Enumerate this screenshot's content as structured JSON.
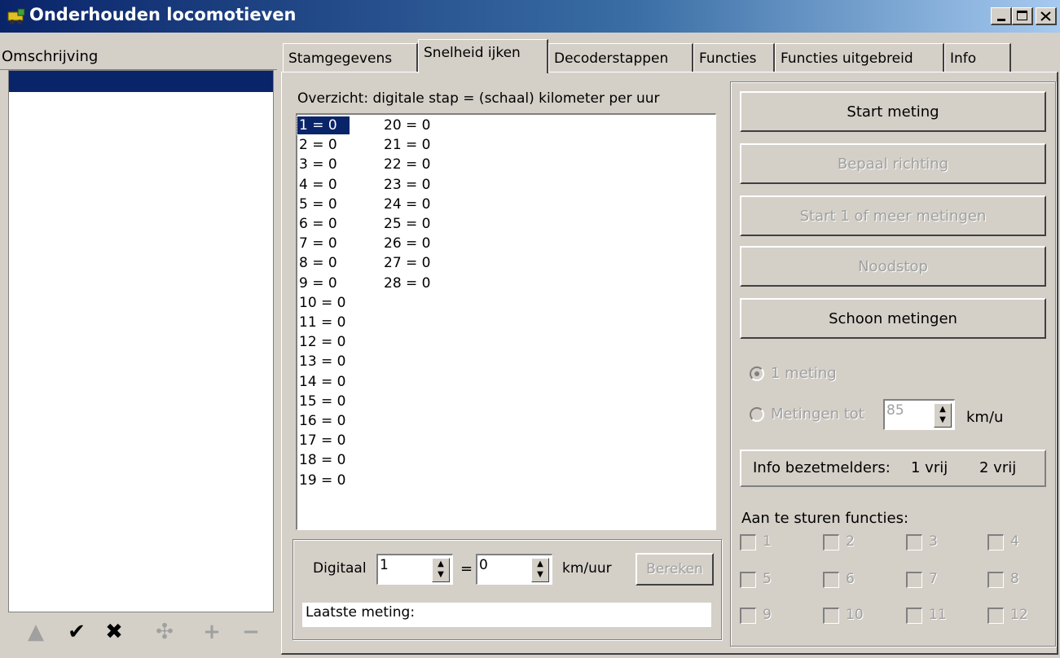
{
  "window": {
    "title": "Onderhouden locomotieven",
    "icon": "locomotive-app-icon",
    "caption_buttons": [
      "minimize",
      "maximize",
      "close"
    ]
  },
  "left_panel": {
    "header": "Omschrijving",
    "toolbar_icons": [
      "up-arrow-icon",
      "check-icon",
      "x-icon",
      "puzzle-icon",
      "plus-icon",
      "minus-icon"
    ]
  },
  "tabs": [
    {
      "label": "Stamgegevens",
      "active": false
    },
    {
      "label": "Snelheid ijken",
      "active": true
    },
    {
      "label": "Decoderstappen",
      "active": false
    },
    {
      "label": "Functies",
      "active": false
    },
    {
      "label": "Functies uitgebreid",
      "active": false
    },
    {
      "label": "Info",
      "active": false
    }
  ],
  "overview": {
    "caption": "Overzicht: digitale stap = (schaal) kilometer per uur",
    "column1": [
      "1 = 0",
      "2 = 0",
      "3 = 0",
      "4 = 0",
      "5 = 0",
      "6 = 0",
      "7 = 0",
      "8 = 0",
      "9 = 0",
      "10 = 0",
      "11 = 0",
      "12 = 0",
      "13 = 0",
      "14 = 0",
      "15 = 0",
      "16 = 0",
      "17 = 0",
      "18 = 0",
      "19 = 0"
    ],
    "column2": [
      "20 = 0",
      "21 = 0",
      "22 = 0",
      "23 = 0",
      "24 = 0",
      "25 = 0",
      "26 = 0",
      "27 = 0",
      "28 = 0"
    ],
    "selected": "1 = 0"
  },
  "calc": {
    "digital_label": "Digitaal",
    "digital_value": "1",
    "equals": "=",
    "speed_value": "0",
    "unit": "km/uur",
    "calc_button": "Bereken",
    "last_measurement": "Laatste meting:"
  },
  "buttons": {
    "start": "Start meting",
    "direction": "Bepaal richting",
    "start_multi": "Start 1 of meer metingen",
    "emergency": "Noodstop",
    "clean": "Schoon metingen"
  },
  "options": {
    "one_measure": "1 meting",
    "measure_until": "Metingen tot",
    "until_value": "85",
    "unit": "km/u",
    "selected": "1 meting"
  },
  "info": {
    "label": "Info bezetmelders:",
    "s1": "1 vrij",
    "s2": "2 vrij"
  },
  "functions": {
    "label": "Aan te sturen functies:",
    "items": [
      "1",
      "2",
      "3",
      "4",
      "5",
      "6",
      "7",
      "8",
      "9",
      "10",
      "11",
      "12"
    ]
  },
  "colors": {
    "face": "#d4d0c8",
    "selection": "#0a246a",
    "disabled_text": "#a0a0a0"
  }
}
